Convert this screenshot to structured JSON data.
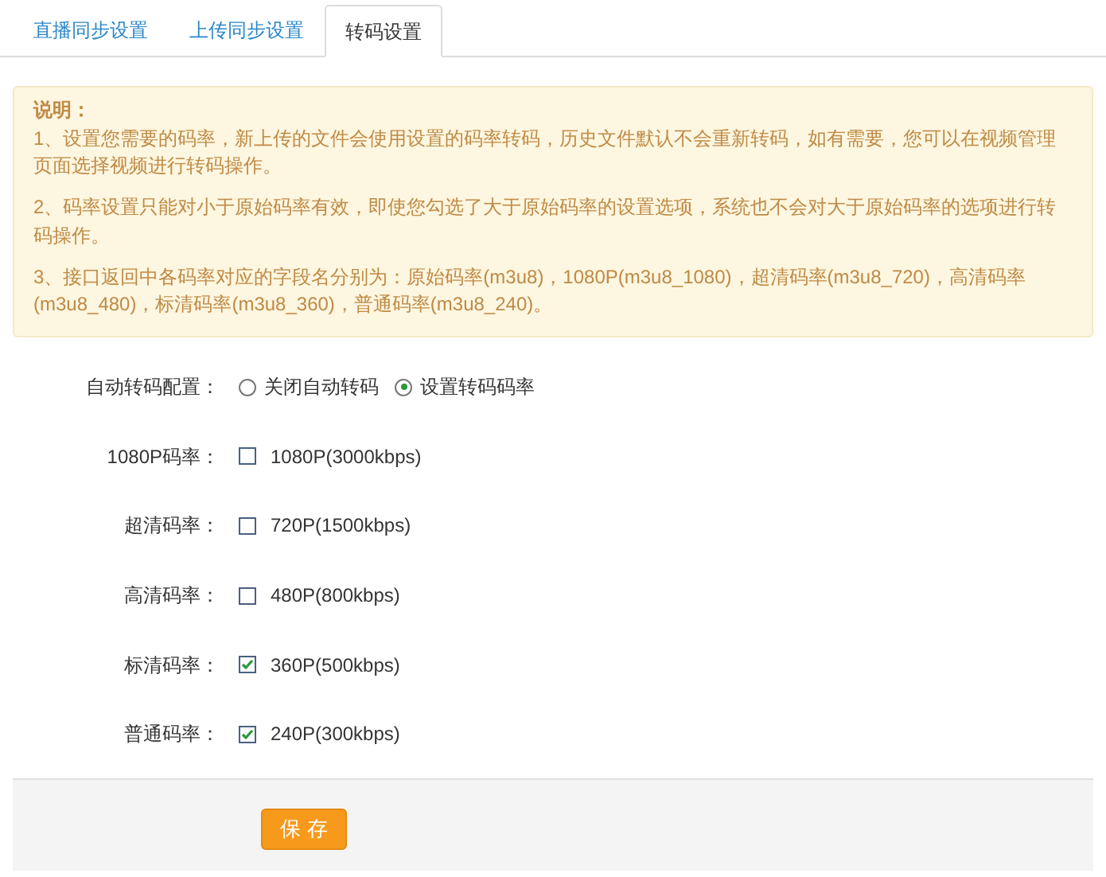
{
  "tabs": [
    {
      "label": "直播同步设置",
      "selected": false
    },
    {
      "label": "上传同步设置",
      "selected": false
    },
    {
      "label": "转码设置",
      "selected": true
    }
  ],
  "notice": {
    "title": "说明：",
    "paragraphs": [
      "1、设置您需要的码率，新上传的文件会使用设置的码率转码，历史文件默认不会重新转码，如有需要，您可以在视频管理页面选择视频进行转码操作。",
      "2、码率设置只能对小于原始码率有效，即使您勾选了大于原始码率的设置选项，系统也不会对大于原始码率的选项进行转码操作。",
      "3、接口返回中各码率对应的字段名分别为：原始码率(m3u8)，1080P(m3u8_1080)，超清码率(m3u8_720)，高清码率(m3u8_480)，标清码率(m3u8_360)，普通码率(m3u8_240)。"
    ]
  },
  "form": [
    {
      "kind": "radio",
      "label": "自动转码配置：",
      "options": [
        {
          "label": "关闭自动转码",
          "selected": false
        },
        {
          "label": "设置转码码率",
          "selected": true
        }
      ]
    },
    {
      "kind": "checkbox",
      "label": "1080P码率：",
      "option": "1080P(3000kbps)",
      "checked": false
    },
    {
      "kind": "checkbox",
      "label": "超清码率：",
      "option": "720P(1500kbps)",
      "checked": false
    },
    {
      "kind": "checkbox",
      "label": "高清码率：",
      "option": "480P(800kbps)",
      "checked": false
    },
    {
      "kind": "checkbox",
      "label": "标清码率：",
      "option": "360P(500kbps)",
      "checked": true
    },
    {
      "kind": "checkbox",
      "label": "普通码率：",
      "option": "240P(300kbps)",
      "checked": true
    }
  ],
  "save_button": "保 存"
}
